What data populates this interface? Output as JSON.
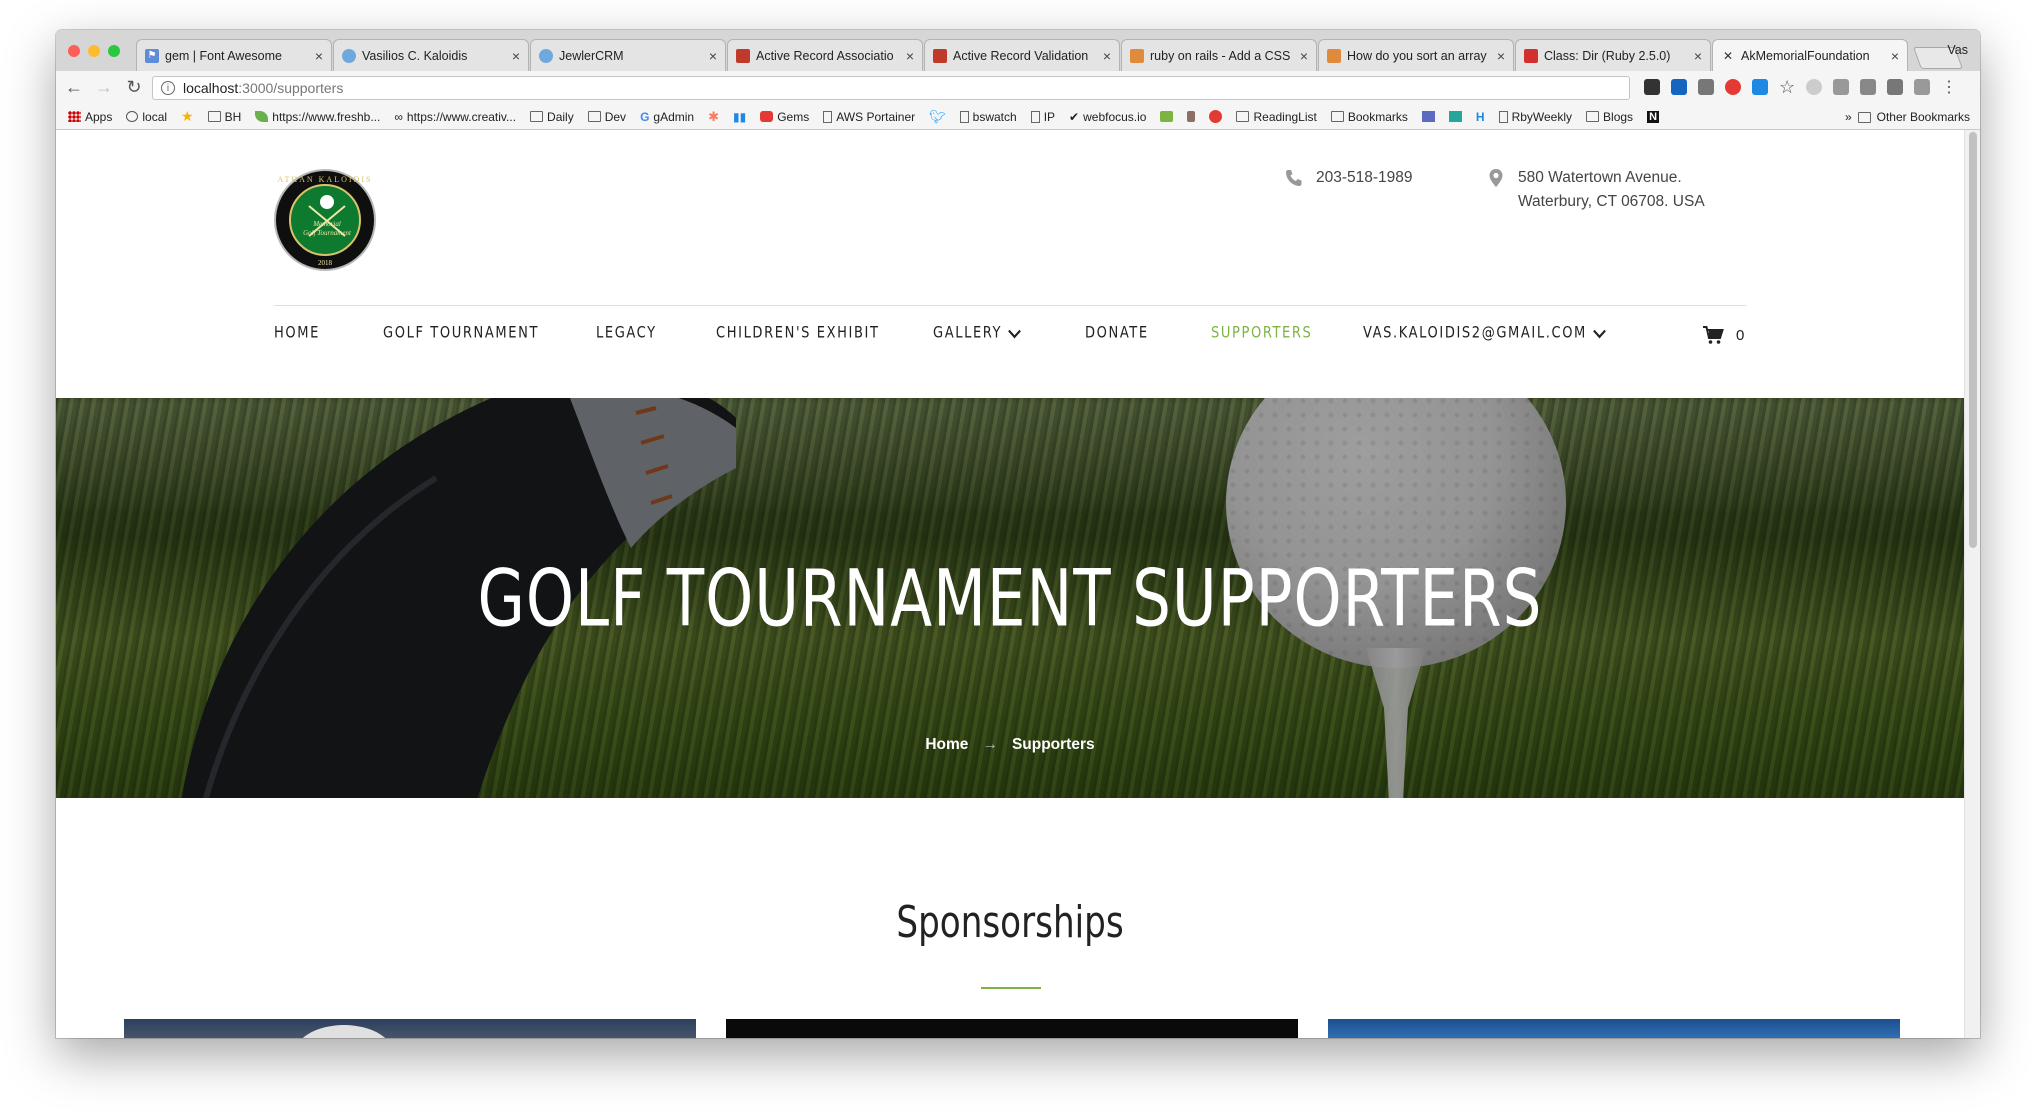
{
  "browser": {
    "tabs": [
      {
        "title": "gem | Font Awesome",
        "color": "#5f8bd9"
      },
      {
        "title": "Vasilios C. Kaloidis",
        "color": "#6fa8dc"
      },
      {
        "title": "JewlerCRM",
        "color": "#6fa8dc"
      },
      {
        "title": "Active Record Associatio",
        "color": "#c0392b"
      },
      {
        "title": "Active Record Validation",
        "color": "#c0392b"
      },
      {
        "title": "ruby on rails - Add a CSS",
        "color": "#e08a3c"
      },
      {
        "title": "How do you sort an array",
        "color": "#e08a3c"
      },
      {
        "title": "Class: Dir (Ruby 2.5.0)",
        "color": "#d32f2f"
      },
      {
        "title": "AkMemorialFoundation",
        "color": "#555555"
      }
    ],
    "profile": "Vas",
    "url_host": "localhost",
    "url_path": ":3000/supporters",
    "bookmarks": [
      "Apps",
      "local",
      "BH",
      "https://www.freshb...",
      "https://www.creativ...",
      "Daily",
      "Dev",
      "gAdmin",
      "Gems",
      "AWS Portainer",
      "bswatch",
      "IP",
      "webfocus.io",
      "ReadingList",
      "Bookmarks",
      "RbyWeekly",
      "Blogs"
    ],
    "bookmarks_overflow": "»",
    "other_bookmarks": "Other Bookmarks"
  },
  "site": {
    "logo": {
      "ring_text": "ATHAN KALOIDIS",
      "line1": "Memorial",
      "line2": "Golf Tournament",
      "year": "2018"
    },
    "phone": "203-518-1989",
    "address_line1": "580 Watertown Avenue.",
    "address_line2": "Waterbury, CT 06708. USA",
    "nav": [
      {
        "label": "HOME"
      },
      {
        "label": "GOLF TOURNAMENT"
      },
      {
        "label": "LEGACY"
      },
      {
        "label": "CHILDREN'S EXHIBIT"
      },
      {
        "label": "GALLERY"
      },
      {
        "label": "DONATE"
      },
      {
        "label": "SUPPORTERS"
      },
      {
        "label": "VAS.KALOIDIS2@GMAIL.COM"
      }
    ],
    "cart_count": "0",
    "accent_color": "#7cb342"
  },
  "hero": {
    "title": "GOLF TOURNAMENT SUPPORTERS",
    "breadcrumb_home": "Home",
    "breadcrumb_sep": "→",
    "breadcrumb_current": "Supporters"
  },
  "content": {
    "section_title": "Sponsorships"
  }
}
